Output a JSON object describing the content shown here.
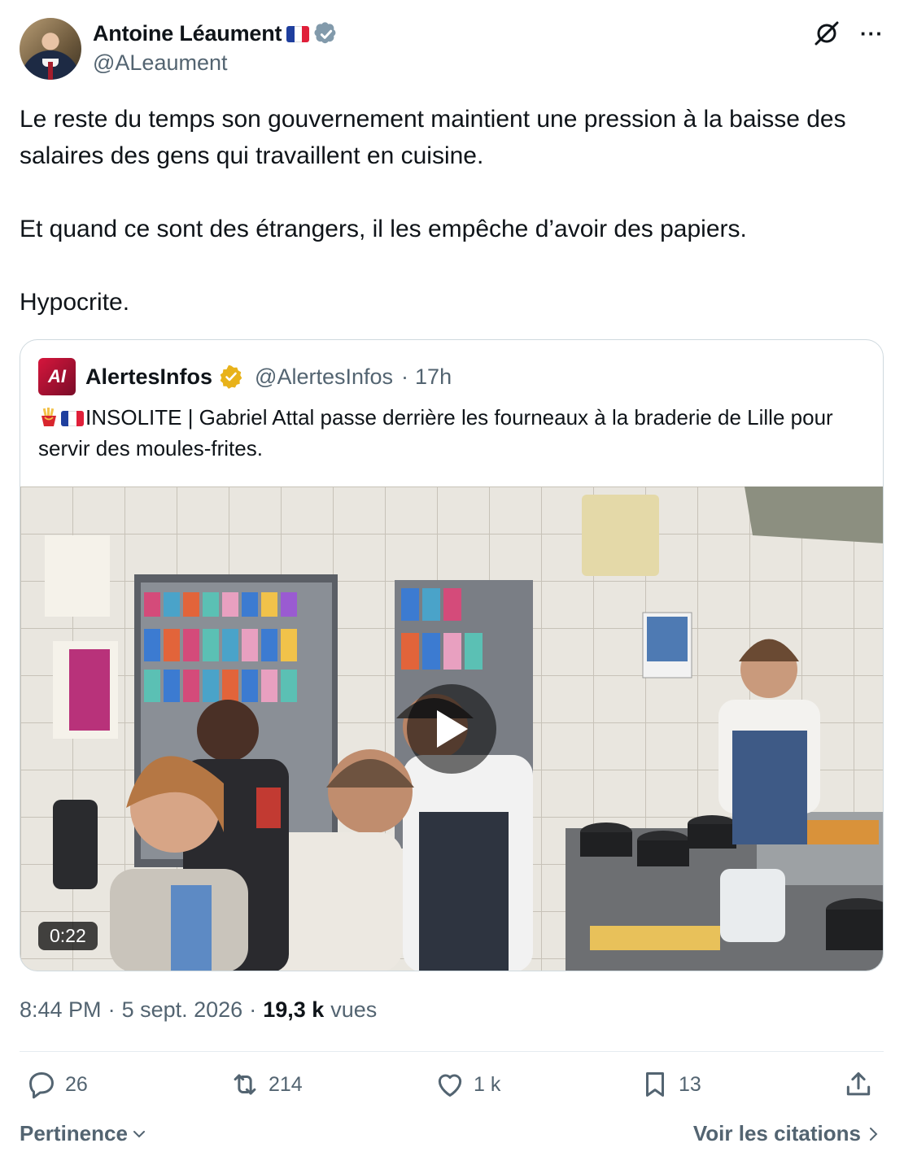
{
  "author": {
    "display_name": "Antoine Léaument",
    "handle": "@ALeaument",
    "verified": true,
    "flag": "France"
  },
  "tweet": {
    "paragraphs": [
      "Le reste du temps son gouvernement maintient une pression à la baisse des salaires des gens qui travaillent en cuisine.",
      "Et quand ce sont des étrangers, il les empêche d’avoir des papiers.",
      "Hypocrite."
    ]
  },
  "quoted": {
    "avatar_text": "AI",
    "display_name": "AlertesInfos",
    "handle": "@AlertesInfos",
    "separator": "·",
    "time": "17h",
    "text": "INSOLITE | Gabriel Attal passe derrière les fourneaux à la braderie de Lille pour servir des moules-frites.",
    "video": {
      "duration": "0:22",
      "icon": "play-icon"
    }
  },
  "meta": {
    "time": "8:44 PM",
    "sep1": "·",
    "date": "5 sept. 2026",
    "sep2": "·",
    "views_count": "19,3 k",
    "views_label": "vues"
  },
  "actions": {
    "replies": "26",
    "reposts": "214",
    "likes": "1 k",
    "bookmarks": "13"
  },
  "footer": {
    "sort_label": "Pertinence",
    "quotes_label": "Voir les citations"
  },
  "colors": {
    "text": "#0f1419",
    "secondary": "#536471",
    "border": "#cfd9de",
    "verified_blue": "#829aab",
    "gold_badge": "#e8b21a"
  }
}
